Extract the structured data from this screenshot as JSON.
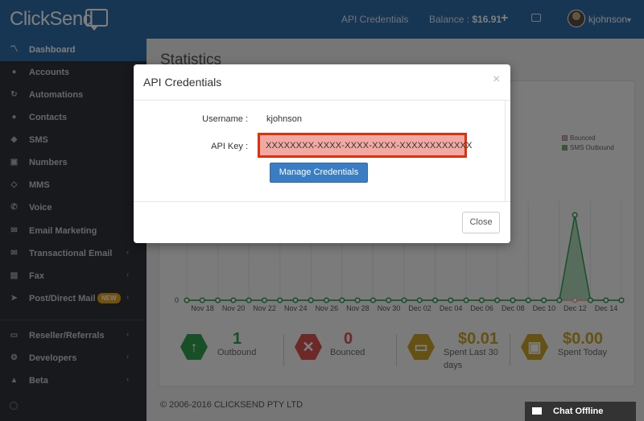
{
  "topbar": {
    "logo": "ClickSend",
    "api_credentials_link": "API Credentials",
    "balance_label": "Balance : ",
    "balance_value": "$16.91",
    "username": "kjohnson"
  },
  "sidebar": {
    "items": [
      {
        "label": "Dashboard",
        "icon": "chart-icon",
        "active": true
      },
      {
        "label": "Accounts",
        "icon": "user-icon"
      },
      {
        "label": "Automations",
        "icon": "refresh-icon"
      },
      {
        "label": "Contacts",
        "icon": "users-icon"
      },
      {
        "label": "SMS",
        "icon": "comment-icon"
      },
      {
        "label": "Numbers",
        "icon": "phone-numbers-icon"
      },
      {
        "label": "MMS",
        "icon": "mms-icon"
      },
      {
        "label": "Voice",
        "icon": "phone-icon"
      },
      {
        "label": "Email Marketing",
        "icon": "envelope-icon"
      },
      {
        "label": "Transactional Email",
        "icon": "envelope-solid-icon"
      },
      {
        "label": "Fax",
        "icon": "fax-icon"
      },
      {
        "label": "Post/Direct Mail",
        "icon": "send-icon",
        "badge": "NEW"
      },
      {
        "label": "Reseller/Referrals",
        "icon": "money-icon"
      },
      {
        "label": "Developers",
        "icon": "cogs-icon"
      },
      {
        "label": "Beta",
        "icon": "flask-icon"
      }
    ]
  },
  "main": {
    "title": "Statistics",
    "chart": {
      "zero_label": "0",
      "legend": [
        {
          "label": "Bounced",
          "color": "#e8a0a0"
        },
        {
          "label": "SMS Outbound",
          "color": "#5cb85c"
        }
      ],
      "ticks": [
        "Nov 18",
        "Nov 20",
        "Nov 22",
        "Nov 24",
        "Nov 26",
        "Nov 28",
        "Nov 30",
        "Dec 02",
        "Dec 04",
        "Dec 06",
        "Dec 08",
        "Dec 10",
        "Dec 12",
        "Dec 14"
      ]
    },
    "stats": [
      {
        "value": "1",
        "label": "Outbound",
        "color": "#2e9e4f",
        "icon": "arrow-up-icon"
      },
      {
        "value": "0",
        "label": "Bounced",
        "color": "#d9534f",
        "icon": "x-icon"
      },
      {
        "value": "$0.01",
        "label": "Spent Last 30 days",
        "color": "#c9a227",
        "icon": "credit-card-icon"
      },
      {
        "value": "$0.00",
        "label": "Spent Today",
        "color": "#c9a227",
        "icon": "money-icon"
      }
    ],
    "footer": "© 2006-2016 CLICKSEND PTY LTD"
  },
  "chat": {
    "label": "Chat Offline"
  },
  "modal": {
    "title": "API Credentials",
    "close_glyph": "×",
    "username_label": "Username :",
    "username_value": "kjohnson",
    "api_key_label": "API Key :",
    "api_key_value": "XXXXXXXX-XXXX-XXXX-XXXX-XXXXXXXXXXXX",
    "manage_button": "Manage Credentials",
    "close_button": "Close"
  },
  "chart_data": {
    "type": "line",
    "x": [
      "Nov 17",
      "Nov 18",
      "Nov 19",
      "Nov 20",
      "Nov 21",
      "Nov 22",
      "Nov 23",
      "Nov 24",
      "Nov 25",
      "Nov 26",
      "Nov 27",
      "Nov 28",
      "Nov 29",
      "Nov 30",
      "Dec 01",
      "Dec 02",
      "Dec 03",
      "Dec 04",
      "Dec 05",
      "Dec 06",
      "Dec 07",
      "Dec 08",
      "Dec 09",
      "Dec 10",
      "Dec 11",
      "Dec 12",
      "Dec 13",
      "Dec 14",
      "Dec 15"
    ],
    "series": [
      {
        "name": "Bounced",
        "values": [
          0,
          0,
          0,
          0,
          0,
          0,
          0,
          0,
          0,
          0,
          0,
          0,
          0,
          0,
          0,
          0,
          0,
          0,
          0,
          0,
          0,
          0,
          0,
          0,
          0,
          0,
          0,
          0,
          0
        ]
      },
      {
        "name": "SMS Outbound",
        "values": [
          0,
          0,
          0,
          0,
          0,
          0,
          0,
          0,
          0,
          0,
          0,
          0,
          0,
          0,
          0,
          0,
          0,
          0,
          0,
          0,
          0,
          0,
          0,
          0,
          0,
          1,
          0,
          0,
          0
        ]
      }
    ],
    "ylim": [
      0,
      1
    ],
    "legend": "top-right"
  }
}
